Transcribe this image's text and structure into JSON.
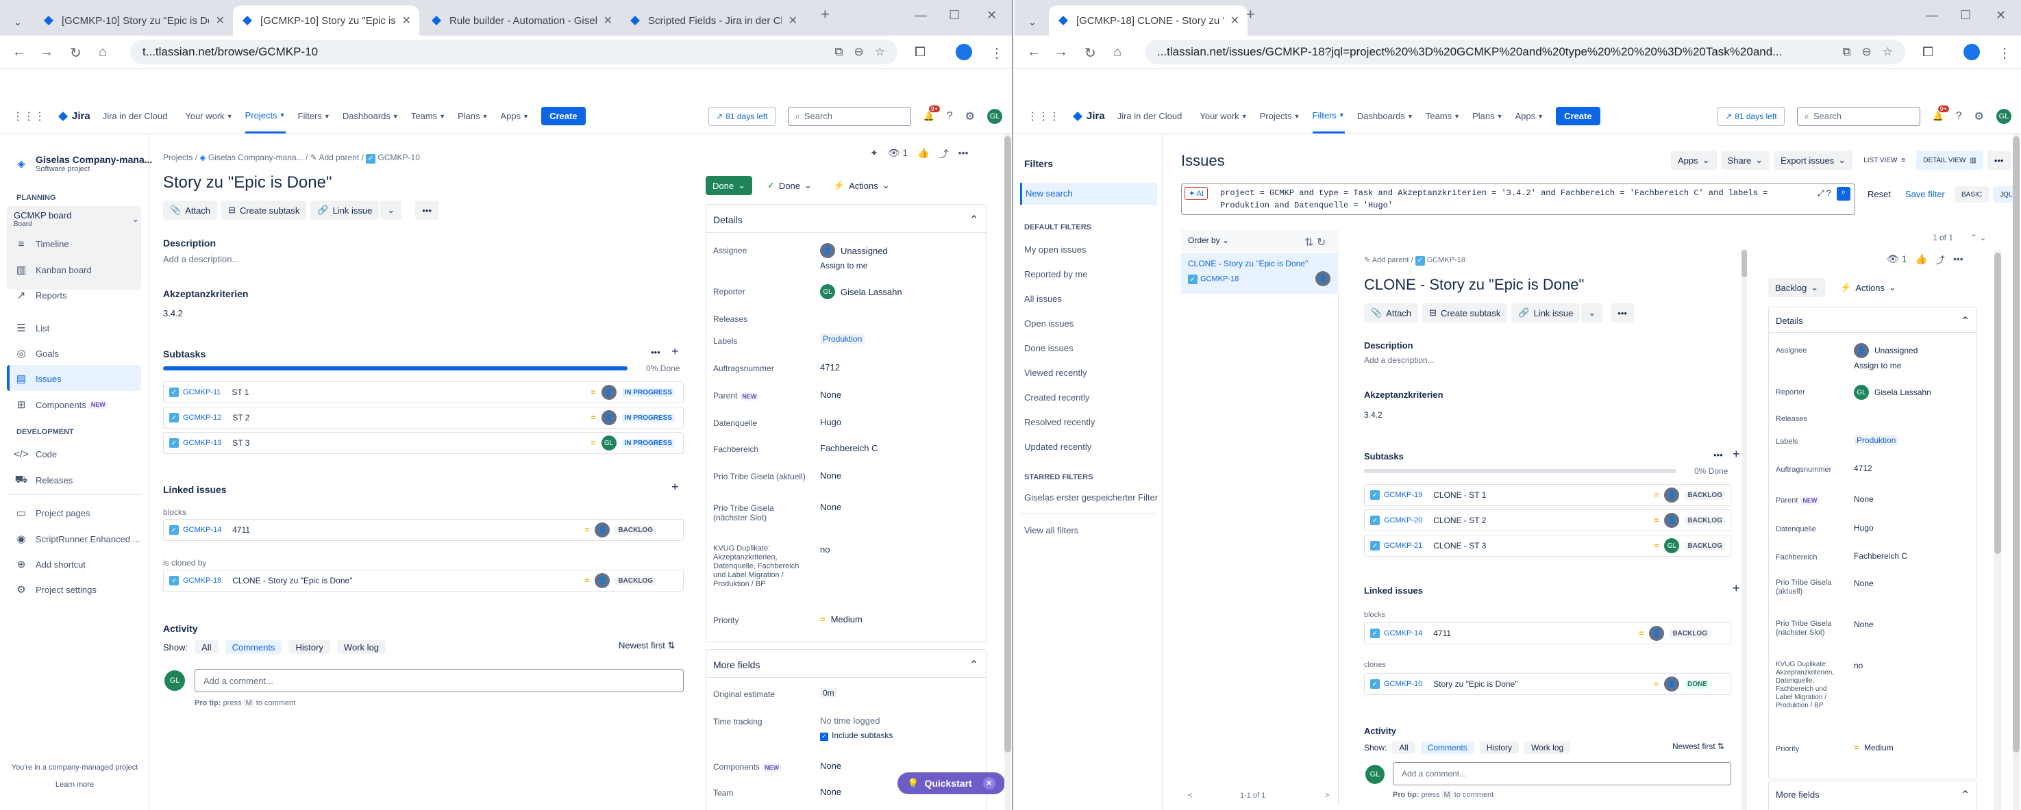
{
  "left": {
    "tabs": [
      {
        "label": "[GCMKP-10] Story zu \"Epic is Done\""
      },
      {
        "label": "[GCMKP-10] Story zu \"Epic is Done\""
      },
      {
        "label": "Rule builder - Automation - Gisela"
      },
      {
        "label": "Scripted Fields - Jira in der Cloud"
      }
    ],
    "url": "t...tlassian.net/browse/GCMKP-10",
    "topnav": {
      "product": "Jira",
      "cloud": "Jira in der Cloud",
      "your_work": "Your work",
      "projects": "Projects",
      "filters": "Filters",
      "dashboards": "Dashboards",
      "teams": "Teams",
      "plans": "Plans",
      "apps": "Apps",
      "create": "Create",
      "trial": "81 days left",
      "search": "Search",
      "notif": "9+",
      "avatar": "GL"
    },
    "sidebar": {
      "project": "Giselas Company-mana...",
      "project_type": "Software project",
      "planning": "PLANNING",
      "board": "GCMKP board",
      "board_sub": "Board",
      "timeline": "Timeline",
      "kanban": "Kanban board",
      "reports": "Reports",
      "list": "List",
      "goals": "Goals",
      "issues": "Issues",
      "components": "Components",
      "new": "NEW",
      "development": "DEVELOPMENT",
      "code": "Code",
      "releases": "Releases",
      "project_pages": "Project pages",
      "scriptrunner": "ScriptRunner Enhanced ...",
      "add_shortcut": "Add shortcut",
      "project_settings": "Project settings",
      "footer": "You're in a company-managed project",
      "learn_more": "Learn more"
    },
    "issue": {
      "crumb_projects": "Projects",
      "crumb_project": "Giselas Company-mana...",
      "crumb_add_parent": "Add parent",
      "crumb_key": "GCMKP-10",
      "watchers": "1",
      "title": "Story zu \"Epic is Done\"",
      "attach": "Attach",
      "create_subtask": "Create subtask",
      "link_issue": "Link issue",
      "description_h": "Description",
      "description_ph": "Add a description...",
      "akz_h": "Akzeptanzkriterien",
      "akz_v": "3.4.2",
      "subtasks_h": "Subtasks",
      "subtasks_pct": "0% Done",
      "subtasks": [
        {
          "key": "GCMKP-11",
          "title": "ST 1",
          "status": "IN PROGRESS",
          "av": ""
        },
        {
          "key": "GCMKP-12",
          "title": "ST 2",
          "status": "IN PROGRESS",
          "av": ""
        },
        {
          "key": "GCMKP-13",
          "title": "ST 3",
          "status": "IN PROGRESS",
          "av": "GL"
        }
      ],
      "linked_h": "Linked issues",
      "blocks": "blocks",
      "blocks_key": "GCMKP-14",
      "blocks_title": "4711",
      "blocks_status": "BACKLOG",
      "cloned_by": "is cloned by",
      "cloned_key": "GCMKP-18",
      "cloned_title": "CLONE - Story zu \"Epic is Done\"",
      "cloned_status": "BACKLOG",
      "activity_h": "Activity",
      "show": "Show:",
      "all": "All",
      "comments": "Comments",
      "history": "History",
      "worklog": "Work log",
      "newest": "Newest first",
      "comment_ph": "Add a comment...",
      "pro_tip": "Pro tip:",
      "press": "press",
      "m": "M",
      "to_comment": "to comment",
      "status": "Done",
      "status2": "Done",
      "actions": "Actions",
      "details_h": "Details",
      "fields": {
        "assignee_l": "Assignee",
        "assignee_v": "Unassigned",
        "assign_me": "Assign to me",
        "reporter_l": "Reporter",
        "reporter_v": "Gisela Lassahn",
        "releases_l": "Releases",
        "labels_l": "Labels",
        "labels_v": "Produktion",
        "auftrag_l": "Auftragsnummer",
        "auftrag_v": "4712",
        "parent_l": "Parent",
        "parent_v": "None",
        "datenquelle_l": "Datenquelle",
        "datenquelle_v": "Hugo",
        "fachbereich_l": "Fachbereich",
        "fachbereich_v": "Fachbereich C",
        "prio_akt_l": "Prio Tribe Gisela (aktuell)",
        "prio_akt_v": "None",
        "prio_next_l": "Prio Tribe Gisela (nächster Slot)",
        "prio_next_v": "None",
        "kvug_l": "KVUG Duplikate: Akzeptanzkriterien, Datenquelle, Fachbereich und Label Migration / Produktion / BP",
        "kvug_v": "no",
        "priority_l": "Priority",
        "priority_v": "Medium"
      },
      "more_h": "More fields",
      "more": {
        "orig_l": "Original estimate",
        "orig_v": "0m",
        "time_l": "Time tracking",
        "time_v": "No time logged",
        "include": "Include subtasks",
        "comp_l": "Components",
        "comp_v": "None",
        "team_l": "Team",
        "team_v": "None"
      },
      "quickstart": "Quickstart"
    }
  },
  "right": {
    "tabs": [
      {
        "label": "[GCMKP-18] CLONE - Story zu \"Epi"
      }
    ],
    "url": "...tlassian.net/issues/GCMKP-18?jql=project%20%3D%20GCMKP%20and%20type%20%20%20%3D%20Task%20and...",
    "filters_side": {
      "title": "Filters",
      "new_search": "New search",
      "default_h": "DEFAULT FILTERS",
      "items": [
        "My open issues",
        "Reported by me",
        "All issues",
        "Open issues",
        "Done issues",
        "Viewed recently",
        "Created recently",
        "Resolved recently",
        "Updated recently"
      ],
      "starred_h": "STARRED FILTERS",
      "starred": "Giselas erster gespeicherter Filter",
      "view_all": "View all filters"
    },
    "issues_h": "Issues",
    "apps": "Apps",
    "share": "Share",
    "export": "Export issues",
    "list_view": "LIST VIEW",
    "detail_view": "DETAIL VIEW",
    "ai": "AI",
    "jql_line1": "project = GCMKP and type    = Task and Akzeptanzkriterien = '3.4.2' and Fachbereich = 'Fachbereich C' and labels  =",
    "jql_line2": "Produktion and Datenquelle = 'Hugo'",
    "reset": "Reset",
    "save_filter": "Save filter",
    "basic": "BASIC",
    "jql": "JQL",
    "order_by": "Order by",
    "count": "1 of 1",
    "count2": "1-1 of 1",
    "result_title": "CLONE - Story zu \"Epic is Done\"",
    "result_key": "GCMKP-18",
    "issue": {
      "add_parent": "Add parent",
      "key": "GCMKP-18",
      "title": "CLONE - Story zu \"Epic is Done\"",
      "attach": "Attach",
      "create_subtask": "Create subtask",
      "link_issue": "Link issue",
      "description_h": "Description",
      "description_ph": "Add a description...",
      "akz_h": "Akzeptanzkriterien",
      "akz_v": "3.4.2",
      "subtasks_h": "Subtasks",
      "subtasks_pct": "0% Done",
      "subtasks": [
        {
          "key": "GCMKP-19",
          "title": "CLONE - ST 1",
          "status": "BACKLOG",
          "av": ""
        },
        {
          "key": "GCMKP-20",
          "title": "CLONE - ST 2",
          "status": "BACKLOG",
          "av": ""
        },
        {
          "key": "GCMKP-21",
          "title": "CLONE - ST 3",
          "status": "BACKLOG",
          "av": "GL"
        }
      ],
      "linked_h": "Linked issues",
      "blocks": "blocks",
      "blocks_key": "GCMKP-14",
      "blocks_title": "4711",
      "blocks_status": "BACKLOG",
      "clones": "clones",
      "clones_key": "GCMKP-10",
      "clones_title": "Story zu \"Epic is Done\"",
      "clones_status": "DONE",
      "activity_h": "Activity",
      "show": "Show:",
      "all": "All",
      "comments": "Comments",
      "history": "History",
      "worklog": "Work log",
      "newest": "Newest first",
      "comment_ph": "Add a comment...",
      "pro_tip": "Pro tip:",
      "press": "press",
      "m": "M",
      "to_comment": "to comment",
      "status": "Backlog",
      "actions": "Actions",
      "details_h": "Details",
      "watchers": "1",
      "fields": {
        "assignee_l": "Assignee",
        "assignee_v": "Unassigned",
        "assign_me": "Assign to me",
        "reporter_l": "Reporter",
        "reporter_v": "Gisela Lassahn",
        "releases_l": "Releases",
        "labels_l": "Labels",
        "labels_v": "Produktion",
        "auftrag_l": "Auftragsnummer",
        "auftrag_v": "4712",
        "parent_l": "Parent",
        "parent_v": "None",
        "datenquelle_l": "Datenquelle",
        "datenquelle_v": "Hugo",
        "fachbereich_l": "Fachbereich",
        "fachbereich_v": "Fachbereich C",
        "prio_akt_l": "Prio Tribe Gisela (aktuell)",
        "prio_akt_v": "None",
        "prio_next_l": "Prio Tribe Gisela (nächster Slot)",
        "prio_next_v": "None",
        "kvug_l": "KVUG Duplikate: Akzeptanzkriterien, Datenquelle, Fachbereich und Label Migration / Produktion / BP",
        "kvug_v": "no",
        "priority_l": "Priority",
        "priority_v": "Medium",
        "more_h": "More fields"
      }
    }
  }
}
